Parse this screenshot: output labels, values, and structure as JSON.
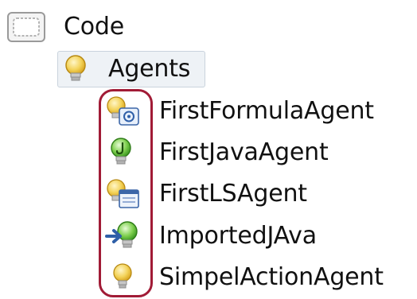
{
  "tree": {
    "root": {
      "label": "Code",
      "icon": "code-folder-icon"
    },
    "agents": {
      "label": "Agents",
      "icon": "lightbulb-icon",
      "selected": true,
      "children": [
        {
          "label": "FirstFormulaAgent",
          "icon": "formula-agent-icon"
        },
        {
          "label": "FirstJavaAgent",
          "icon": "java-agent-icon"
        },
        {
          "label": "FirstLSAgent",
          "icon": "lotusscript-agent-icon"
        },
        {
          "label": "ImportedJAva",
          "icon": "imported-java-agent-icon"
        },
        {
          "label": "SimpelActionAgent",
          "icon": "simple-action-agent-icon"
        }
      ]
    }
  },
  "colors": {
    "annotation_outline": "#a11b36",
    "selection_background": "#eef2f6",
    "bulb_yellow": "#f3d35a",
    "java_green": "#5bbf3a",
    "import_blue": "#2f5fa8"
  }
}
